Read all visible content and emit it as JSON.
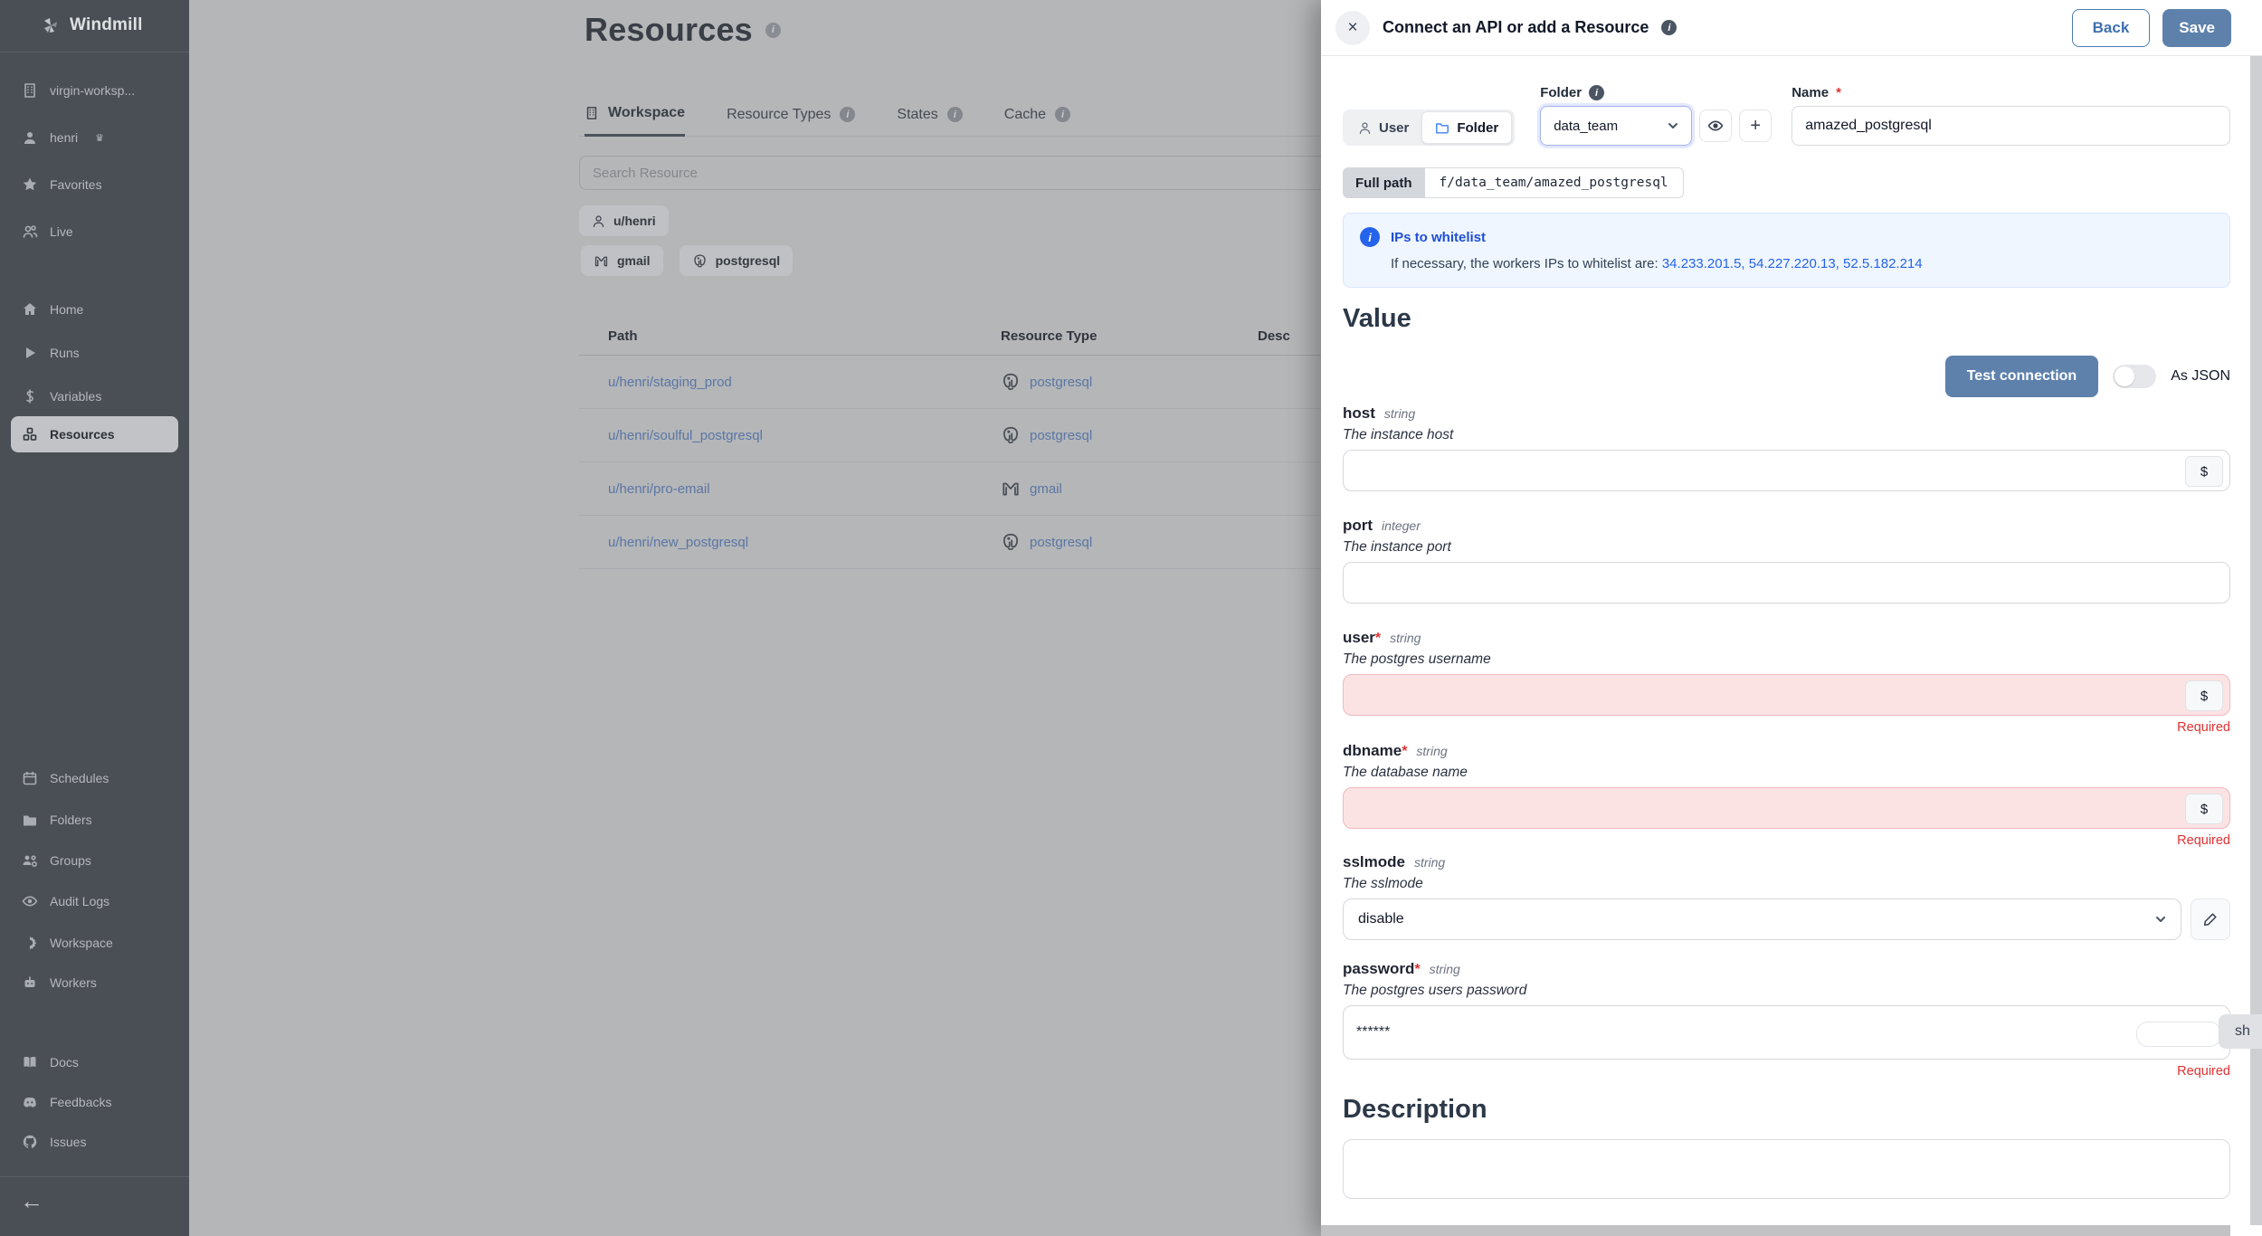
{
  "sidebar": {
    "logo_label": "Windmill",
    "workspace_label": "virgin-worksp...",
    "user_label": "henri",
    "favorites_label": "Favorites",
    "live_label": "Live",
    "nav": {
      "home": "Home",
      "runs": "Runs",
      "variables": "Variables",
      "resources": "Resources"
    },
    "admin": {
      "schedules": "Schedules",
      "folders": "Folders",
      "groups": "Groups",
      "audit_logs": "Audit Logs",
      "workspace": "Workspace",
      "workers": "Workers"
    },
    "footer": {
      "docs": "Docs",
      "feedbacks": "Feedbacks",
      "issues": "Issues"
    }
  },
  "main": {
    "title": "Resources",
    "tabs": {
      "workspace": "Workspace",
      "resource_types": "Resource Types",
      "states": "States",
      "cache": "Cache"
    },
    "search_placeholder": "Search Resource",
    "owner_chip": "u/henri",
    "chip_gmail": "gmail",
    "chip_postgresql": "postgresql",
    "table": {
      "col_path": "Path",
      "col_type": "Resource Type",
      "col_desc": "Desc",
      "rows": [
        {
          "path": "u/henri/staging_prod",
          "type": "postgresql"
        },
        {
          "path": "u/henri/soulful_postgresql",
          "type": "postgresql"
        },
        {
          "path": "u/henri/pro-email",
          "type": "gmail"
        },
        {
          "path": "u/henri/new_postgresql",
          "type": "postgresql"
        }
      ]
    }
  },
  "drawer": {
    "title": "Connect an API or add a Resource",
    "back_label": "Back",
    "save_label": "Save",
    "owner_toggle": {
      "user": "User",
      "folder": "Folder"
    },
    "folder_label": "Folder",
    "folder_value": "data_team",
    "name_label": "Name",
    "name_value": "amazed_postgresql",
    "full_path_label": "Full path",
    "full_path_value": "f/data_team/amazed_postgresql",
    "info": {
      "title": "IPs to whitelist",
      "body_prefix": "If necessary, the workers IPs to whitelist are: ",
      "ips": "34.233.201.5, 54.227.220.13, 52.5.182.214"
    },
    "value_heading": "Value",
    "test_connection_label": "Test connection",
    "as_json_label": "As JSON",
    "required_label": "Required",
    "show_fragment": "sh",
    "fields": [
      {
        "name": "host",
        "type": "string",
        "desc": "The instance host"
      },
      {
        "name": "port",
        "type": "integer",
        "desc": "The instance port"
      },
      {
        "name": "user",
        "type": "string",
        "desc": "The postgres username"
      },
      {
        "name": "dbname",
        "type": "string",
        "desc": "The database name"
      },
      {
        "name": "sslmode",
        "type": "string",
        "desc": "The sslmode",
        "value": "disable"
      },
      {
        "name": "password",
        "type": "string",
        "desc": "The postgres users password",
        "value": "******"
      }
    ],
    "description_heading": "Description"
  },
  "icons": {
    "close": "×",
    "plus": "+",
    "dollar": "$",
    "back_arrow": "←",
    "crown": "♛",
    "info": "i"
  },
  "colors": {
    "accent_blue": "#5e81ac",
    "link_blue": "#2563eb",
    "info_blue": "#1d4ed8",
    "error_red": "#e03131",
    "required_bg": "#fbe3e4",
    "sidebar_bg": "#4a4f55",
    "overlay_gray": "#b4b6b8"
  }
}
